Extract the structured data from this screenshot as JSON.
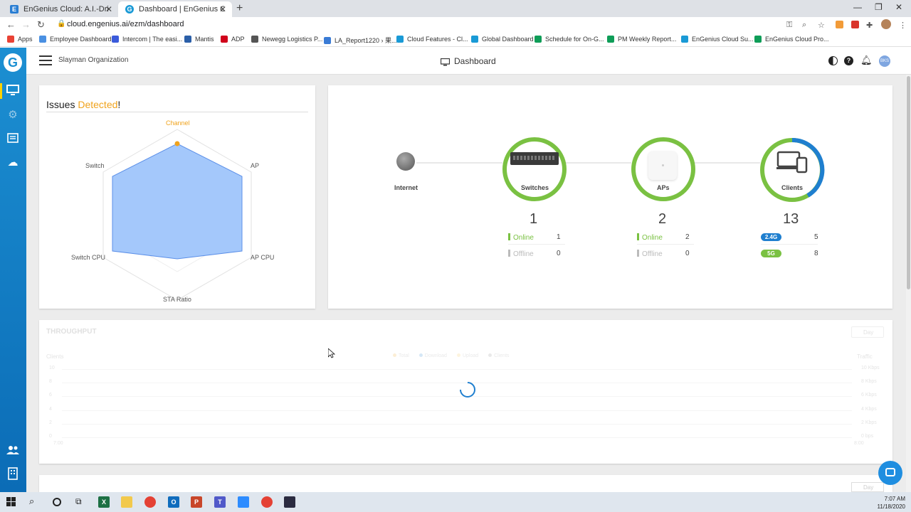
{
  "browser": {
    "tabs": [
      {
        "title": "EnGenius Cloud: A.I.-Driven Sma",
        "favicon": "E",
        "favicon_color": "#2a7ed3"
      },
      {
        "title": "Dashboard | EnGenius Cloud - S",
        "favicon": "G",
        "favicon_color": "#1a9ad6"
      }
    ],
    "url": "cloud.engenius.ai/ezm/dashboard",
    "bookmarks": [
      {
        "label": "Apps",
        "color": "#e94235"
      },
      {
        "label": "Employee Dashboard",
        "color": "#4a90e2"
      },
      {
        "label": "Intercom | The easi...",
        "color": "#3b5bdb"
      },
      {
        "label": "Mantis",
        "color": "#2b5fa8"
      },
      {
        "label": "ADP",
        "color": "#d0021b"
      },
      {
        "label": "Newegg Logistics P...",
        "color": "#555555"
      },
      {
        "label": "LA_Report1220 › 果...",
        "color": "#3a7bd5"
      },
      {
        "label": "Cloud Features - Cl...",
        "color": "#1a9ad6"
      },
      {
        "label": "Global Dashboard",
        "color": "#1a9ad6"
      },
      {
        "label": "Schedule for On-G...",
        "color": "#0f9d58"
      },
      {
        "label": "PM Weekly Report...",
        "color": "#0f9d58"
      },
      {
        "label": "EnGenius Cloud Su...",
        "color": "#1a9ad6"
      },
      {
        "label": "EnGenius Cloud Pro...",
        "color": "#0f9d58"
      }
    ]
  },
  "header": {
    "org": "Slayman Organization",
    "page_title": "Dashboard",
    "avatar": "BKS"
  },
  "issues": {
    "title_prefix": "Issues ",
    "title_highlight": "Detected",
    "title_suffix": "!",
    "highlight_color": "#f0a31c",
    "radar_labels": [
      "Channel",
      "AP",
      "AP CPU",
      "STA Ratio",
      "Switch CPU",
      "Switch"
    ]
  },
  "topology": {
    "internet_label": "Internet",
    "switches": {
      "label": "Switches",
      "count": "1",
      "online_label": "Online",
      "online": "1",
      "offline_label": "Offline",
      "offline": "0"
    },
    "aps": {
      "label": "APs",
      "count": "2",
      "online_label": "Online",
      "online": "2",
      "offline_label": "Offline",
      "offline": "0"
    },
    "clients": {
      "label": "Clients",
      "count": "13",
      "band1_label": "2.4G",
      "band1": "5",
      "band2_label": "5G",
      "band2": "8"
    }
  },
  "throughput": {
    "title": "THROUGHPUT",
    "range_label": "Day",
    "y_left_title": "Clients",
    "y_left_ticks": [
      "10",
      "8",
      "6",
      "4",
      "2",
      "0"
    ],
    "y_right_title": "Traffic",
    "y_right_ticks": [
      "10 Kbps",
      "8 Kbps",
      "6 Kbps",
      "4 Kbps",
      "2 Kbps",
      "0 bps"
    ],
    "legend": [
      "Total",
      "Download",
      "Upload",
      "Clients"
    ],
    "x_start": "7:00",
    "x_end": "8:00"
  },
  "lower_card": {
    "range_label": "Day"
  },
  "taskbar": {
    "time": "7:07 AM",
    "date": "11/18/2020"
  }
}
